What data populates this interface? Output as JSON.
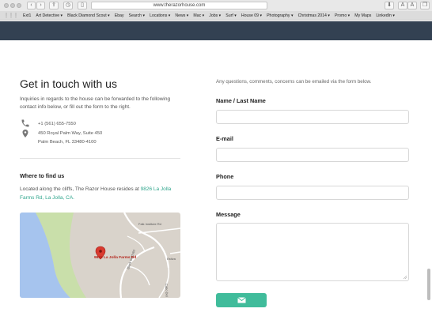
{
  "browser": {
    "url": "www.therazorhouse.com",
    "bookmarks": [
      "Ext1",
      "Art Detective ▾",
      "Black Diamond Scout ▾",
      "Ebay",
      "Search ▾",
      "Locations ▾",
      "News ▾",
      "Mac ▾",
      "Jobs ▾",
      "Surf ▾",
      "House 09 ▾",
      "Photography ▾",
      "Christmas 2014 ▾",
      "Promo ▾",
      "My Maps",
      "LinkedIn ▾"
    ],
    "right_buttons": [
      "A",
      "A"
    ]
  },
  "contact": {
    "heading": "Get in touch with us",
    "intro": "Inquiries in regards to the house can be forwarded to the following contact info below, or fill out the form to the right.",
    "phone": "+1 (561) 655-7550",
    "address_line1": "450 Royal Palm Way, Suite 450",
    "address_line2": "Palm Beach, FL 33480-4100"
  },
  "find": {
    "heading": "Where to find us",
    "text_before": "Located along the cliffs, The Razor House resides at ",
    "address_link": "9826 La Jolla Farms Rd, La Jolla, CA."
  },
  "map": {
    "pin_label": "9826 La Jolla Farms Rd",
    "street1": "Falk Institute Rd",
    "street2": "Black Gold Rd",
    "street3": "Estiva",
    "street4": "Cabo Del"
  },
  "form": {
    "note": "Any questions, comments, concerns can be emailed via the form below.",
    "name_label": "Name / Last Name",
    "email_label": "E-mail",
    "phone_label": "Phone",
    "message_label": "Message"
  },
  "colors": {
    "accent": "#40bc9b",
    "nav": "#334152",
    "link": "#2fa58c"
  }
}
